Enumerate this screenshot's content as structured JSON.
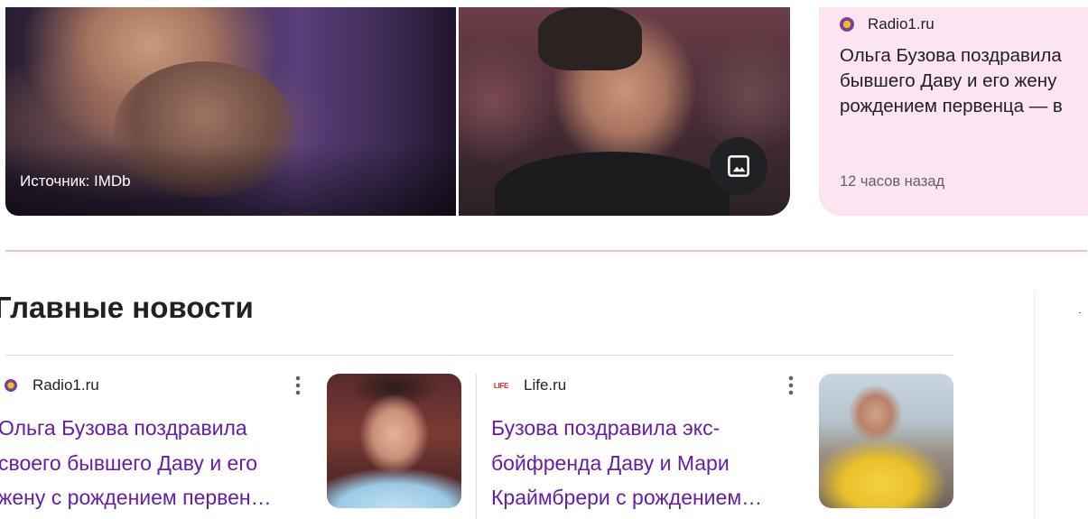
{
  "image_carousel": {
    "source_caption": "Источник: IMDb",
    "gallery_icon": "image-gallery-icon"
  },
  "side_card": {
    "source_name": "Radio1.ru",
    "source_icon": "radio1-favicon",
    "headline_lines": [
      "Ольга Бузова поздравила",
      "бывшего Даву и его жену",
      "рождением первенца — в"
    ],
    "time": "12 часов назад",
    "background_color": "#fce4f0"
  },
  "top_stories": {
    "title": "Главные новости",
    "stories": [
      {
        "source_name": "Radio1.ru",
        "source_icon": "radio1-favicon",
        "headline_lines": [
          "Ольга Бузова поздравила",
          "своего бывшего Даву и его",
          "жену с рождением первен…"
        ],
        "more_icon": "more-vert-icon"
      },
      {
        "source_name": "Life.ru",
        "source_icon": "life-favicon",
        "favicon_text": "LIFE",
        "headline_lines": [
          "Бузова поздравила экс-",
          "бойфренда Даву и Мари",
          "Краймбрери с рождением…"
        ],
        "more_icon": "more-vert-icon"
      }
    ]
  },
  "colors": {
    "visited_link": "#681da8",
    "divider_accent": "#f7b8dc",
    "text_primary": "#202124",
    "text_secondary": "#5f6368"
  }
}
